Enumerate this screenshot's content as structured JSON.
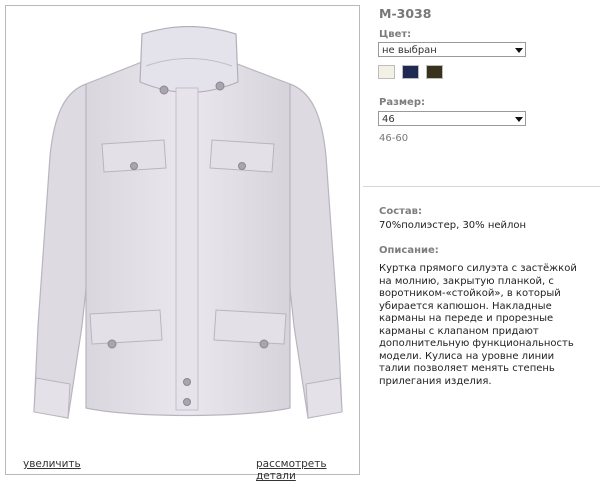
{
  "product": {
    "code": "М-3038",
    "color_label": "Цвет:",
    "color_select": "не выбран",
    "swatches": [
      {
        "color": "#f3f0e6",
        "name": "cream"
      },
      {
        "color": "#1f2a52",
        "name": "navy"
      },
      {
        "color": "#38321c",
        "name": "olive"
      }
    ],
    "size_label": "Размер:",
    "size_select": "46",
    "size_range": "46-60",
    "composition_label": "Состав:",
    "composition": "70%полиэстер, 30% нейлон",
    "description_label": "Описание:",
    "description": "Куртка прямого силуэта с застёжкой на молнию, закрытую планкой, с воротником-«стойкой», в который убирается капюшон. Накладные карманы на переде и прорезные карманы с клапаном придают дополнительную функциональность модели. Кулиса на уровне линии талии позволяет менять степень прилегания изделия."
  },
  "photo": {
    "zoom_link": "увеличить",
    "details_link": "рассмотреть детали"
  }
}
